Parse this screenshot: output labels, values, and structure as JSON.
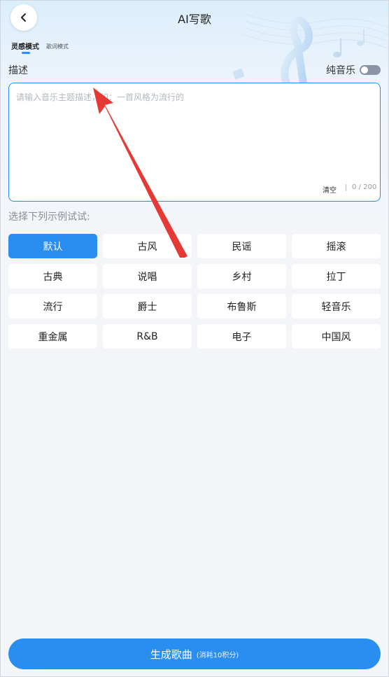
{
  "header": {
    "title": "AI写歌"
  },
  "tabs": [
    {
      "label": "灵感模式",
      "active": true
    },
    {
      "label": "歌词模式",
      "active": false
    }
  ],
  "description": {
    "label": "描述",
    "placeholder": "请输入音乐主题描述，如：一首风格为流行的",
    "clear_label": "清空",
    "counter": "0 / 200"
  },
  "pure_music": {
    "label": "纯音乐",
    "enabled": false
  },
  "examples": {
    "label": "选择下列示例试试:",
    "items": [
      {
        "label": "默认",
        "selected": true
      },
      {
        "label": "古风"
      },
      {
        "label": "民谣"
      },
      {
        "label": "摇滚"
      },
      {
        "label": "古典"
      },
      {
        "label": "说唱"
      },
      {
        "label": "乡村"
      },
      {
        "label": "拉丁"
      },
      {
        "label": "流行"
      },
      {
        "label": "爵士"
      },
      {
        "label": "布鲁斯"
      },
      {
        "label": "轻音乐"
      },
      {
        "label": "重金属"
      },
      {
        "label": "R&B"
      },
      {
        "label": "电子"
      },
      {
        "label": "中国风"
      }
    ]
  },
  "generate": {
    "label": "生成歌曲",
    "cost_label": "(消耗10积分)"
  },
  "icons": {
    "back": "chevron-left-icon",
    "decoration": "treble-clef-music-note-icon",
    "annotation": "red-arrow-icon"
  },
  "colors": {
    "accent": "#2a8ef0",
    "arrow": "#e53935",
    "toggle_off": "#8a94a6"
  }
}
